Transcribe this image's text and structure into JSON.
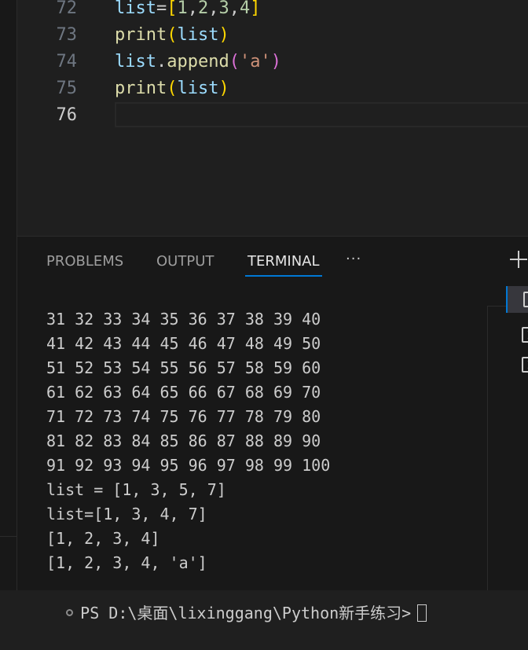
{
  "editor": {
    "lines": [
      {
        "num": "72",
        "tokens": [
          [
            "var",
            "list"
          ],
          [
            "pl",
            "="
          ],
          [
            "br",
            "["
          ],
          [
            "num",
            "1"
          ],
          [
            "pl",
            ","
          ],
          [
            "num",
            "2"
          ],
          [
            "pl",
            ","
          ],
          [
            "num",
            "3"
          ],
          [
            "pl",
            ","
          ],
          [
            "num",
            "4"
          ],
          [
            "br",
            "]"
          ]
        ]
      },
      {
        "num": "73",
        "tokens": [
          [
            "fn",
            "print"
          ],
          [
            "br",
            "("
          ],
          [
            "var",
            "list"
          ],
          [
            "br",
            ")"
          ]
        ]
      },
      {
        "num": "74",
        "tokens": [
          [
            "var",
            "list"
          ],
          [
            "pl",
            "."
          ],
          [
            "fn",
            "append"
          ],
          [
            "pr",
            "("
          ],
          [
            "str",
            "'a'"
          ],
          [
            "pr",
            ")"
          ]
        ]
      },
      {
        "num": "75",
        "tokens": [
          [
            "fn",
            "print"
          ],
          [
            "br",
            "("
          ],
          [
            "var",
            "list"
          ],
          [
            "br",
            ")"
          ]
        ]
      },
      {
        "num": "76",
        "tokens": []
      }
    ],
    "active_line": "76"
  },
  "panel": {
    "tabs": {
      "problems": "PROBLEMS",
      "output": "OUTPUT",
      "terminal": "TERMINAL"
    },
    "active_tab": "terminal",
    "more_label": "···",
    "new_terminal_icon": "plus-icon"
  },
  "terminal": {
    "output_lines": [
      "31 32 33 34 35 36 37 38 39 40",
      "41 42 43 44 45 46 47 48 49 50",
      "51 52 53 54 55 56 57 58 59 60",
      "61 62 63 64 65 66 67 68 69 70",
      "71 72 73 74 75 76 77 78 79 80",
      "81 82 83 84 85 86 87 88 89 90",
      "91 92 93 94 95 96 97 98 99 100",
      "list = [1, 3, 5, 7]",
      "list=[1, 3, 4, 7]",
      "[1, 2, 3, 4]",
      "[1, 2, 3, 4, 'a']"
    ],
    "prompt": "PS D:\\桌面\\lixinggang\\Python新手练习>",
    "instances": [
      "terminal-1",
      "terminal-2",
      "terminal-3"
    ]
  },
  "colors": {
    "accent": "#0078d4",
    "background": "#1f1f1f",
    "panel_background": "#181818"
  }
}
